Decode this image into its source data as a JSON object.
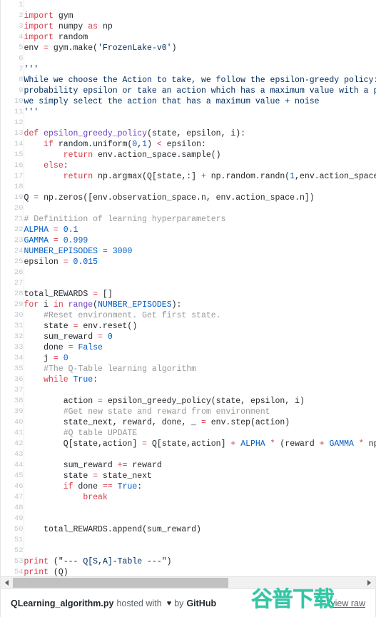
{
  "gist": {
    "filename": "QLearning_algorithm.py",
    "hosted_with": "hosted with",
    "heart_icon": "heart-icon",
    "heart_glyph": "♥",
    "by": "by",
    "host": "GitHub",
    "view_raw": "view raw"
  },
  "watermark": {
    "text": "谷普下载",
    "color": "#35c6a5"
  },
  "scrollbar": {
    "left_arrow": "scroll-left-arrow",
    "right_arrow": "scroll-right-arrow",
    "thumb": "scroll-thumb"
  },
  "colors": {
    "keyword": "#d73a49",
    "function": "#6f42c1",
    "string": "#032f62",
    "comment": "#969896",
    "constant": "#005cc5",
    "text": "#24292e",
    "line_number": "#c3c7cb",
    "background": "#ffffff",
    "scrollbar_track": "#f1f1f1",
    "scrollbar_thumb": "#c1c1c1"
  },
  "code": {
    "language": "python",
    "first_line": 1,
    "last_line": 54,
    "lines": [
      {
        "n": 1,
        "tokens": []
      },
      {
        "n": 2,
        "tokens": [
          [
            "k",
            "import"
          ],
          [
            "p",
            " gym"
          ]
        ]
      },
      {
        "n": 3,
        "tokens": [
          [
            "k",
            "import"
          ],
          [
            "p",
            " numpy "
          ],
          [
            "k",
            "as"
          ],
          [
            "p",
            " np"
          ]
        ]
      },
      {
        "n": 4,
        "tokens": [
          [
            "k",
            "import"
          ],
          [
            "p",
            " random"
          ]
        ]
      },
      {
        "n": 5,
        "tokens": [
          [
            "p",
            "env "
          ],
          [
            "o",
            "="
          ],
          [
            "p",
            " gym.make("
          ],
          [
            "s",
            "'FrozenLake-v0'"
          ],
          [
            "p",
            ")"
          ]
        ]
      },
      {
        "n": 6,
        "tokens": []
      },
      {
        "n": 7,
        "tokens": [
          [
            "s",
            "'''"
          ]
        ]
      },
      {
        "n": 8,
        "tokens": [
          [
            "s",
            "While we choose the Action to take, we follow the epsilon-greedy policy: w"
          ]
        ]
      },
      {
        "n": 9,
        "tokens": [
          [
            "s",
            "probability epsilon or take an action which has a maximum value with a pro"
          ]
        ]
      },
      {
        "n": 10,
        "tokens": [
          [
            "s",
            "we simply select the action that has a maximum value + noise"
          ]
        ]
      },
      {
        "n": 11,
        "tokens": [
          [
            "s",
            "'''"
          ]
        ]
      },
      {
        "n": 12,
        "tokens": []
      },
      {
        "n": 13,
        "tokens": [
          [
            "k",
            "def"
          ],
          [
            "p",
            " "
          ],
          [
            "fn",
            "epsilon_greedy_policy"
          ],
          [
            "p",
            "(state, epsilon, i):"
          ]
        ]
      },
      {
        "n": 14,
        "tokens": [
          [
            "p",
            "    "
          ],
          [
            "k",
            "if"
          ],
          [
            "p",
            " random.uniform("
          ],
          [
            "n",
            "0"
          ],
          [
            "p",
            ","
          ],
          [
            "n",
            "1"
          ],
          [
            "p",
            ") "
          ],
          [
            "o",
            "<"
          ],
          [
            "p",
            " epsilon:"
          ]
        ]
      },
      {
        "n": 15,
        "tokens": [
          [
            "p",
            "        "
          ],
          [
            "k",
            "return"
          ],
          [
            "p",
            " env.action_space.sample()"
          ]
        ]
      },
      {
        "n": 16,
        "tokens": [
          [
            "p",
            "    "
          ],
          [
            "k",
            "else"
          ],
          [
            "p",
            ":"
          ]
        ]
      },
      {
        "n": 17,
        "tokens": [
          [
            "p",
            "        "
          ],
          [
            "k",
            "return"
          ],
          [
            "p",
            " np.argmax(Q[state,:] "
          ],
          [
            "o",
            "+"
          ],
          [
            "p",
            " np.random.randn("
          ],
          [
            "n",
            "1"
          ],
          [
            "p",
            ",env.action_space.n"
          ]
        ]
      },
      {
        "n": 18,
        "tokens": []
      },
      {
        "n": 19,
        "tokens": [
          [
            "p",
            "Q "
          ],
          [
            "o",
            "="
          ],
          [
            "p",
            " np.zeros([env.observation_space.n, env.action_space.n])"
          ]
        ]
      },
      {
        "n": 20,
        "tokens": []
      },
      {
        "n": 21,
        "tokens": [
          [
            "c",
            "# Definitiion of learning hyperparameters"
          ]
        ]
      },
      {
        "n": 22,
        "tokens": [
          [
            "n",
            "ALPHA"
          ],
          [
            "p",
            " "
          ],
          [
            "o",
            "="
          ],
          [
            "p",
            " "
          ],
          [
            "n",
            "0.1"
          ]
        ]
      },
      {
        "n": 23,
        "tokens": [
          [
            "n",
            "GAMMA"
          ],
          [
            "p",
            " "
          ],
          [
            "o",
            "="
          ],
          [
            "p",
            " "
          ],
          [
            "n",
            "0.999"
          ]
        ]
      },
      {
        "n": 24,
        "tokens": [
          [
            "n",
            "NUMBER_EPISODES"
          ],
          [
            "p",
            " "
          ],
          [
            "o",
            "="
          ],
          [
            "p",
            " "
          ],
          [
            "n",
            "3000"
          ]
        ]
      },
      {
        "n": 25,
        "tokens": [
          [
            "p",
            "epsilon "
          ],
          [
            "o",
            "="
          ],
          [
            "p",
            " "
          ],
          [
            "n",
            "0.015"
          ]
        ]
      },
      {
        "n": 26,
        "tokens": []
      },
      {
        "n": 27,
        "tokens": []
      },
      {
        "n": 28,
        "tokens": [
          [
            "p",
            "total_REWARDS "
          ],
          [
            "o",
            "="
          ],
          [
            "p",
            " []"
          ]
        ]
      },
      {
        "n": 29,
        "tokens": [
          [
            "k",
            "for"
          ],
          [
            "p",
            " i "
          ],
          [
            "k",
            "in"
          ],
          [
            "p",
            " "
          ],
          [
            "fn",
            "range"
          ],
          [
            "p",
            "("
          ],
          [
            "n",
            "NUMBER_EPISODES"
          ],
          [
            "p",
            "):"
          ]
        ]
      },
      {
        "n": 30,
        "tokens": [
          [
            "p",
            "    "
          ],
          [
            "c",
            "#Reset environment. Get first state."
          ]
        ]
      },
      {
        "n": 31,
        "tokens": [
          [
            "p",
            "    state "
          ],
          [
            "o",
            "="
          ],
          [
            "p",
            " env.reset()"
          ]
        ]
      },
      {
        "n": 32,
        "tokens": [
          [
            "p",
            "    sum_reward "
          ],
          [
            "o",
            "="
          ],
          [
            "p",
            " "
          ],
          [
            "n",
            "0"
          ]
        ]
      },
      {
        "n": 33,
        "tokens": [
          [
            "p",
            "    done "
          ],
          [
            "o",
            "="
          ],
          [
            "p",
            " "
          ],
          [
            "n",
            "False"
          ]
        ]
      },
      {
        "n": 34,
        "tokens": [
          [
            "p",
            "    j "
          ],
          [
            "o",
            "="
          ],
          [
            "p",
            " "
          ],
          [
            "n",
            "0"
          ]
        ]
      },
      {
        "n": 35,
        "tokens": [
          [
            "p",
            "    "
          ],
          [
            "c",
            "#The Q-Table learning algorithm"
          ]
        ]
      },
      {
        "n": 36,
        "tokens": [
          [
            "p",
            "    "
          ],
          [
            "k",
            "while"
          ],
          [
            "p",
            " "
          ],
          [
            "n",
            "True"
          ],
          [
            "p",
            ":"
          ]
        ]
      },
      {
        "n": 37,
        "tokens": []
      },
      {
        "n": 38,
        "tokens": [
          [
            "p",
            "        action "
          ],
          [
            "o",
            "="
          ],
          [
            "p",
            " epsilon_greedy_policy(state, epsilon, i)"
          ]
        ]
      },
      {
        "n": 39,
        "tokens": [
          [
            "p",
            "        "
          ],
          [
            "c",
            "#Get new state and reward from environment"
          ]
        ]
      },
      {
        "n": 40,
        "tokens": [
          [
            "p",
            "        state_next, reward, done, _ "
          ],
          [
            "o",
            "="
          ],
          [
            "p",
            " env.step(action)"
          ]
        ]
      },
      {
        "n": 41,
        "tokens": [
          [
            "p",
            "        "
          ],
          [
            "c",
            "#Q table UPDATE"
          ]
        ]
      },
      {
        "n": 42,
        "tokens": [
          [
            "p",
            "        Q[state,action] "
          ],
          [
            "o",
            "="
          ],
          [
            "p",
            " Q[state,action] "
          ],
          [
            "o",
            "+"
          ],
          [
            "p",
            " "
          ],
          [
            "n",
            "ALPHA"
          ],
          [
            "p",
            " "
          ],
          [
            "o",
            "*"
          ],
          [
            "p",
            " (reward "
          ],
          [
            "o",
            "+"
          ],
          [
            "p",
            " "
          ],
          [
            "n",
            "GAMMA"
          ],
          [
            "p",
            " "
          ],
          [
            "o",
            "*"
          ],
          [
            "p",
            " np.m"
          ]
        ]
      },
      {
        "n": 43,
        "tokens": []
      },
      {
        "n": 44,
        "tokens": [
          [
            "p",
            "        sum_reward "
          ],
          [
            "o",
            "+="
          ],
          [
            "p",
            " reward"
          ]
        ]
      },
      {
        "n": 45,
        "tokens": [
          [
            "p",
            "        state "
          ],
          [
            "o",
            "="
          ],
          [
            "p",
            " state_next"
          ]
        ]
      },
      {
        "n": 46,
        "tokens": [
          [
            "p",
            "        "
          ],
          [
            "k",
            "if"
          ],
          [
            "p",
            " done "
          ],
          [
            "o",
            "=="
          ],
          [
            "p",
            " "
          ],
          [
            "n",
            "True"
          ],
          [
            "p",
            ":"
          ]
        ]
      },
      {
        "n": 47,
        "tokens": [
          [
            "p",
            "            "
          ],
          [
            "k",
            "break"
          ]
        ]
      },
      {
        "n": 48,
        "tokens": []
      },
      {
        "n": 49,
        "tokens": []
      },
      {
        "n": 50,
        "tokens": [
          [
            "p",
            "    total_REWARDS.append(sum_reward)"
          ]
        ]
      },
      {
        "n": 51,
        "tokens": []
      },
      {
        "n": 52,
        "tokens": []
      },
      {
        "n": 53,
        "tokens": [
          [
            "k",
            "print"
          ],
          [
            "p",
            " ("
          ],
          [
            "s",
            "\"--- Q[S,A]-Table ---\""
          ],
          [
            "p",
            ")"
          ]
        ]
      },
      {
        "n": 54,
        "tokens": [
          [
            "k",
            "print"
          ],
          [
            "p",
            " (Q)"
          ]
        ]
      }
    ]
  }
}
